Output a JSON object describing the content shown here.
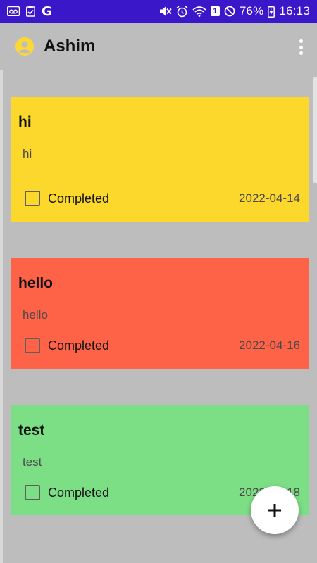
{
  "status_bar": {
    "left_icons": [
      "voicemail-icon",
      "clipboard-check-icon",
      "google-g-icon"
    ],
    "google_letter": "G",
    "right_icons": [
      "mute-icon",
      "alarm-icon",
      "wifi-icon",
      "sim-1-icon",
      "do-not-disturb-icon",
      "battery-charging-icon"
    ],
    "sim_label": "1",
    "battery_percent": "76%",
    "time": "16:13",
    "background_color": "#3a17c8"
  },
  "app_bar": {
    "title": "Ashim",
    "avatar_icon": "account-circle-icon",
    "avatar_color": "#fdd835",
    "menu_icon": "more-vert-icon"
  },
  "notes": [
    {
      "title": "hi",
      "body": "hi",
      "checkbox_label": "Completed",
      "checked": false,
      "date": "2022-04-14",
      "color": "#fdd82c"
    },
    {
      "title": "hello",
      "body": "hello",
      "checkbox_label": "Completed",
      "checked": false,
      "date": "2022-04-16",
      "color": "#ff6347"
    },
    {
      "title": "test",
      "body": "test",
      "checkbox_label": "Completed",
      "checked": false,
      "date": "2022-04-18",
      "color": "#7ddf85"
    }
  ],
  "fab": {
    "icon": "plus-icon"
  }
}
